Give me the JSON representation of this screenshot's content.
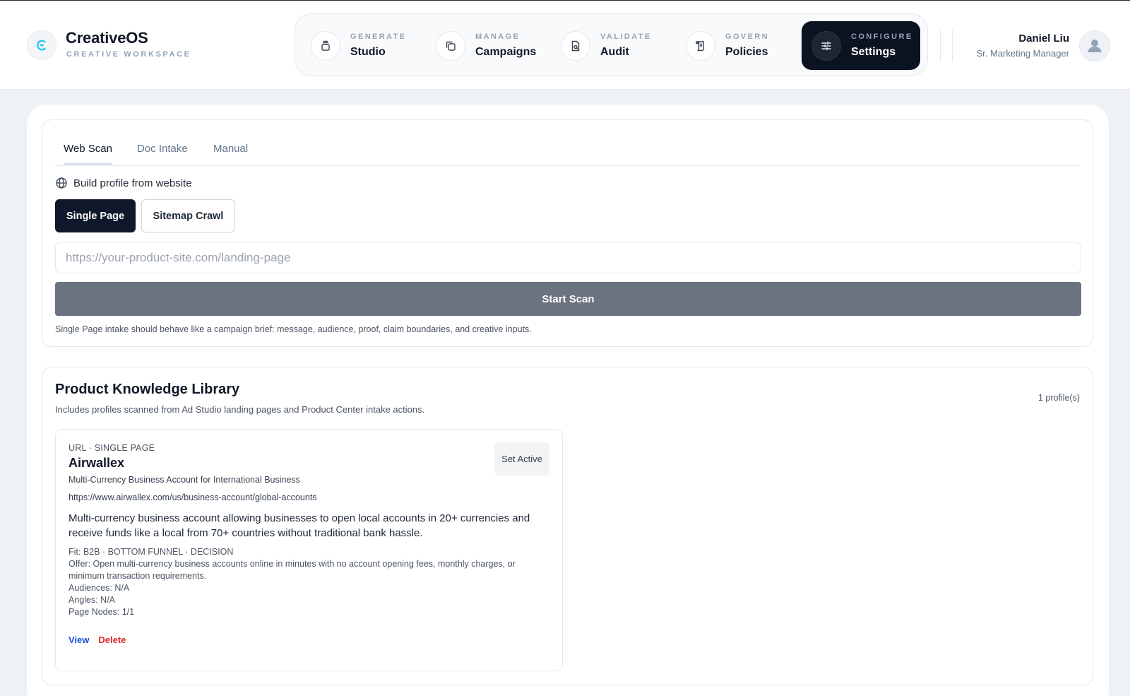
{
  "brand": {
    "name": "CreativeOS",
    "tagline": "CREATIVE WORKSPACE",
    "logo_icon": "brand-c-icon"
  },
  "nav": [
    {
      "kicker": "GENERATE",
      "label": "Studio",
      "icon": "layers-icon",
      "active": false
    },
    {
      "kicker": "MANAGE",
      "label": "Campaigns",
      "icon": "copy-icon",
      "active": false
    },
    {
      "kicker": "VALIDATE",
      "label": "Audit",
      "icon": "file-audit-icon",
      "active": false
    },
    {
      "kicker": "GOVERN",
      "label": "Policies",
      "icon": "scroll-icon",
      "active": false
    },
    {
      "kicker": "CONFIGURE",
      "label": "Settings",
      "icon": "sliders-icon",
      "active": true
    }
  ],
  "user": {
    "name": "Daniel Liu",
    "role": "Sr. Marketing Manager",
    "icon": "user-icon"
  },
  "intake": {
    "tabs": [
      "Web Scan",
      "Doc Intake",
      "Manual"
    ],
    "active_tab": "Web Scan",
    "header": "Build profile from website",
    "header_icon": "globe-icon",
    "modes": {
      "single": "Single Page",
      "sitemap": "Sitemap Crawl",
      "selected": "Single Page"
    },
    "url_placeholder": "https://your-product-site.com/landing-page",
    "url_value": "",
    "start_label": "Start Scan",
    "hint": "Single Page intake should behave like a campaign brief: message, audience, proof, claim boundaries, and creative inputs."
  },
  "library": {
    "title": "Product Knowledge Library",
    "subtitle": "Includes profiles scanned from Ad Studio landing pages and Product Center intake actions.",
    "count": "1 profile(s)",
    "profiles": [
      {
        "kicker": "URL · SINGLE PAGE",
        "name": "Airwallex",
        "tagline": "Multi-Currency Business Account for International Business",
        "url": "https://www.airwallex.com/us/business-account/global-accounts",
        "description": "Multi-currency business account allowing businesses to open local accounts in 20+ currencies and receive funds like a local from 70+ countries without traditional bank hassle.",
        "fit": "Fit: B2B · BOTTOM FUNNEL · DECISION",
        "offer": "Offer: Open multi-currency business accounts online in minutes with no account opening fees, monthly charges, or minimum transaction requirements.",
        "audiences": "Audiences: N/A",
        "angles": "Angles: N/A",
        "page_nodes": "Page Nodes: 1/1",
        "set_active": "Set Active",
        "view": "View",
        "delete": "Delete"
      }
    ]
  },
  "colors": {
    "accent_dark": "#0b1220",
    "start_button": "#6b7280",
    "link_view": "#1d4ed8",
    "link_delete": "#dc2626"
  }
}
